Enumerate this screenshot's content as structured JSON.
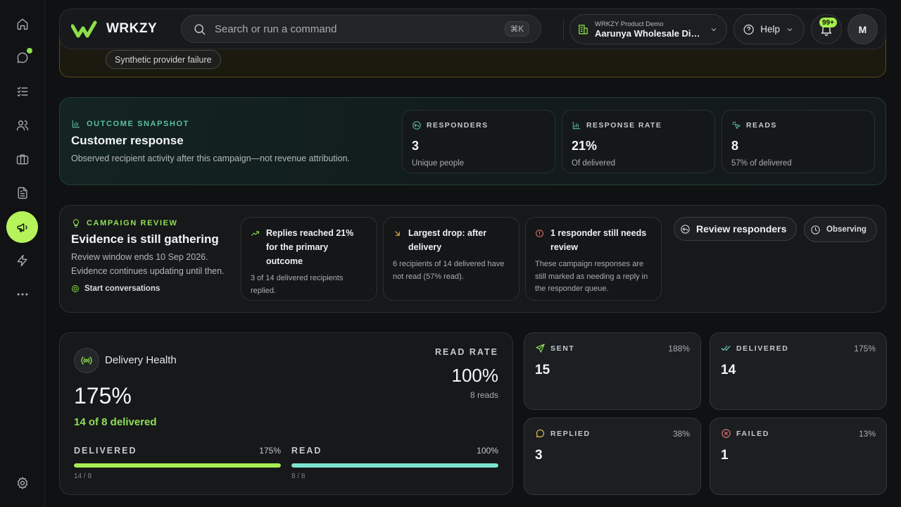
{
  "header": {
    "brand": "WRKZY",
    "search_placeholder": "Search or run a command",
    "shortcut": "⌘K",
    "org_small": "WRKZY Product Demo",
    "org_name": "Aarunya Wholesale Distributors",
    "help": "Help",
    "notif_badge": "99+",
    "avatar": "M"
  },
  "sidebar": {
    "items": [
      "home-icon",
      "chat-icon",
      "tasks-icon",
      "users-icon",
      "briefcase-icon",
      "document-icon",
      "megaphone-icon",
      "bolt-icon",
      "more-icon"
    ],
    "active": "megaphone-icon",
    "bottom": "settings-icon"
  },
  "alert": {
    "chip": "Synthetic provider failure"
  },
  "outcome": {
    "eyebrow": "OUTCOME SNAPSHOT",
    "title": "Customer response",
    "desc": "Observed recipient activity after this campaign—not revenue attribution.",
    "metrics": [
      {
        "label": "RESPONDERS",
        "value": "3",
        "sub": "Unique people",
        "icon": "reply-icon",
        "color": "#59c0a0"
      },
      {
        "label": "RESPONSE RATE",
        "value": "21%",
        "sub": "Of delivered",
        "icon": "bar-chart-icon",
        "color": "#59c0a0"
      },
      {
        "label": "READS",
        "value": "8",
        "sub": "57% of delivered",
        "icon": "sparkle-icon",
        "color": "#59c0a0"
      }
    ]
  },
  "review": {
    "eyebrow": "CAMPAIGN REVIEW",
    "title": "Evidence is still gathering",
    "desc1": "Review window ends 10 Sep 2026.",
    "desc2": "Evidence continues updating until then.",
    "start": "Start conversations",
    "cards": [
      {
        "head": "Replies reached 21% for the primary outcome",
        "body": "3 of 14 delivered recipients replied.",
        "icon": "trend-up-icon",
        "color": "#8fe058"
      },
      {
        "head": "Largest drop: after delivery",
        "body": "6 recipients of 14 delivered have not read (57% read).",
        "icon": "arrow-down-right-icon",
        "color": "#f0c44c"
      },
      {
        "head": "1 responder still needs review",
        "body": "These campaign responses are still marked as needing a reply in the responder queue.",
        "icon": "alert-circle-icon",
        "color": "#f07474"
      }
    ],
    "review_btn": "Review responders",
    "observing": "Observing"
  },
  "health": {
    "title": "Delivery Health",
    "big": "175%",
    "green": "14 of 8 delivered",
    "rr_label": "READ RATE",
    "rr_value": "100%",
    "rr_sub": "8 reads",
    "bars": [
      {
        "name": "DELIVERED",
        "pct": "175%",
        "frac": "14 / 8",
        "fill": 1.0,
        "color": "#a6ec52"
      },
      {
        "name": "READ",
        "pct": "100%",
        "frac": "8 / 8",
        "fill": 1.0,
        "color": "#7de3cf"
      }
    ]
  },
  "stats": [
    {
      "name": "SENT",
      "pct": "188%",
      "value": "15",
      "icon": "send-icon",
      "color": "#8fe058"
    },
    {
      "name": "DELIVERED",
      "pct": "175%",
      "value": "14",
      "icon": "double-check-icon",
      "color": "#7de3cf"
    },
    {
      "name": "REPLIED",
      "pct": "38%",
      "value": "3",
      "icon": "message-circle-icon",
      "color": "#f0c44c"
    },
    {
      "name": "FAILED",
      "pct": "13%",
      "value": "1",
      "icon": "x-circle-icon",
      "color": "#f07474"
    }
  ]
}
